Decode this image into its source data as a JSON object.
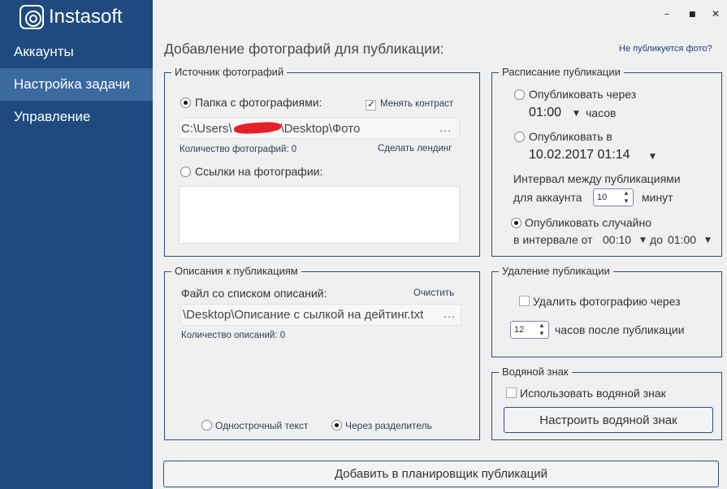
{
  "app": {
    "logo_text": "Instasoft"
  },
  "sidebar": {
    "items": [
      {
        "label": "Аккаунты"
      },
      {
        "label": "Настройка задачи"
      },
      {
        "label": "Управление"
      }
    ]
  },
  "window": {
    "minimize": "–",
    "maximize": "■",
    "close": "✕"
  },
  "page": {
    "title": "Добавление фотографий для публикации:",
    "help_link": "Не публикуется фото?"
  },
  "source": {
    "title": "Источник фотографий",
    "folder_option": "Папка с фотографиями:",
    "contrast_label": "Менять контраст",
    "path_prefix": "C:\\Users\\",
    "path_suffix": "\\Desktop\\Фото",
    "browse": "...",
    "count_label": "Количество фотографий: 0",
    "landing_link": "Сделать лендинг",
    "links_option": "Ссылки на фотографии:"
  },
  "descriptions": {
    "title": "Описания к публикациям",
    "file_label": "Файл со списком описаний:",
    "clear_link": "Очистить",
    "file_path": "\\Desktop\\Описание с сылкой на дейтинг.txt",
    "browse": "...",
    "count_label": "Количество описаний: 0",
    "single_line": "Однострочный текст",
    "separator": "Через разделитель"
  },
  "schedule": {
    "title": "Расписание публикации",
    "publish_after": "Опубликовать через",
    "after_value": "01:00",
    "hours": "часов",
    "publish_at": "Опубликовать в",
    "at_value": "10.02.2017 01:14",
    "interval_line1": "Интервал между публикациями",
    "interval_line2": "для аккаунта",
    "interval_value": "10",
    "minutes": "минут",
    "random": "Опубликовать случайно",
    "random_range_prefix": "в интервале от",
    "random_from": "00:10",
    "random_to_label": "до",
    "random_to": "01:00"
  },
  "deletion": {
    "title": "Удаление публикации",
    "delete_label": "Удалить фотографию через",
    "hours_value": "12",
    "hours_label": "часов после публикации"
  },
  "watermark": {
    "title": "Водяной знак",
    "use_label": "Использовать водяной знак",
    "configure_button": "Настроить водяной знак"
  },
  "footer": {
    "add_button": "Добавить в планировщик публикаций"
  }
}
